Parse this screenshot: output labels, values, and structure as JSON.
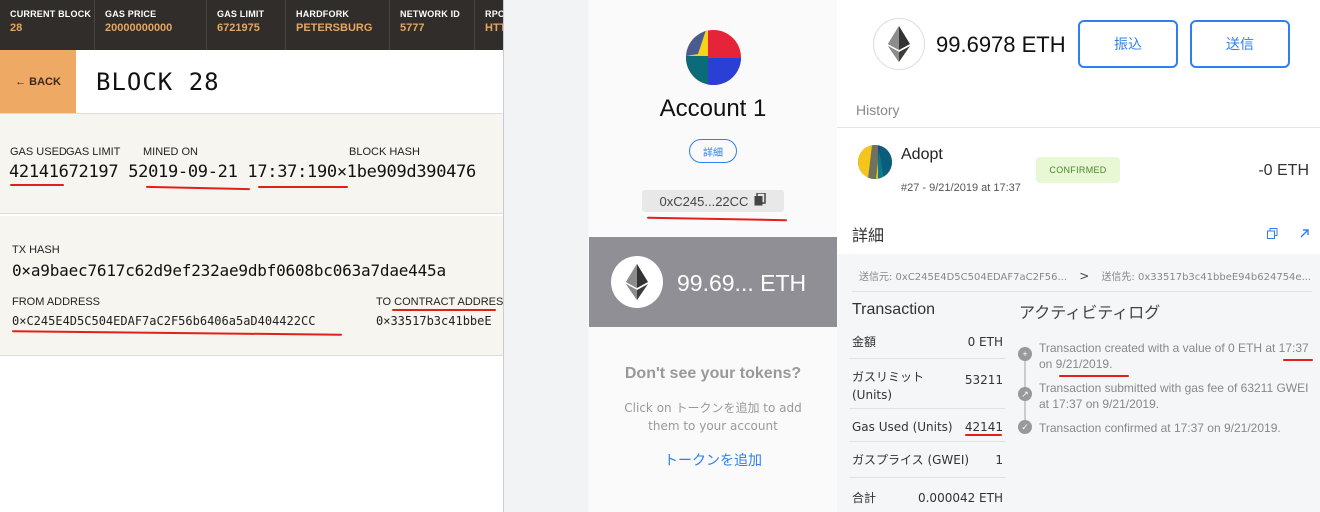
{
  "ganache": {
    "stats": [
      {
        "label": "CURRENT BLOCK",
        "value": "28"
      },
      {
        "label": "GAS PRICE",
        "value": "20000000000"
      },
      {
        "label": "GAS LIMIT",
        "value": "6721975"
      },
      {
        "label": "HARDFORK",
        "value": "PETERSBURG"
      },
      {
        "label": "NETWORK ID",
        "value": "5777"
      },
      {
        "label": "RPC",
        "value": "HTT"
      }
    ],
    "back_label": "← BACK",
    "block_title": "BLOCK 28",
    "block_info": {
      "gas_used_label": "GAS USED",
      "gas_limit_label": "GAS LIMIT",
      "mined_on_label": "MINED ON",
      "block_hash_label": "BLOCK HASH",
      "values_line": "42141672197 52019-09-21  17:37:190×1be909d390476"
    },
    "tx": {
      "tx_hash_label": "TX HASH",
      "tx_hash": "0×a9baec7617c62d9ef232ae9dbf0608bc063a7dae445a",
      "from_label": "FROM ADDRESS",
      "from_value": "0×C245E4D5C504EDAF7aC2F56b6406a5aD404422CC",
      "to_label": "TO CONTRACT ADDRESS",
      "to_value": "0×33517b3c41bbeE"
    }
  },
  "metamask": {
    "account_name": "Account 1",
    "details_button": "詳細",
    "address_short": "0xC245...22CC",
    "sidebar_balance": "99.69...  ETH",
    "dont_see_tokens": "Don't see your tokens?",
    "click_on_text": "Click on トークンを追加 to add them to your account",
    "add_token_link": "トークンを追加",
    "main_balance": "99.6978 ETH",
    "deposit_button": "振込",
    "send_button": "送信",
    "history_label": "History",
    "transaction": {
      "title": "Adopt",
      "subtitle": "#27 - 9/21/2019 at 17:37",
      "status": "CONFIRMED",
      "amount": "-0 ETH"
    },
    "details_label": "詳細",
    "from_to": {
      "from": "送信元: 0xC245E4D5C504EDAF7aC2F56...",
      "arrow": ">",
      "to": "送信先: 0x33517b3c41bbeE94b624754e..."
    },
    "transaction_heading": "Transaction",
    "activity_heading": "アクティビティログ",
    "tx_rows": [
      {
        "key": "金額",
        "value": "0 ETH"
      },
      {
        "key": "ガスリミット (Units)",
        "value": "53211"
      },
      {
        "key": "Gas Used (Units)",
        "value": "42141"
      },
      {
        "key": "ガスプライス (GWEI)",
        "value": "1"
      },
      {
        "key": "合計",
        "value": "0.000042 ETH"
      }
    ],
    "activity": [
      "Transaction created with a value of 0 ETH at 17:37 on 9/21/2019.",
      "Transaction submitted with gas fee of 63211 GWEI at 17:37 on 9/21/2019.",
      "Transaction confirmed at 17:37 on 9/21/2019."
    ]
  }
}
